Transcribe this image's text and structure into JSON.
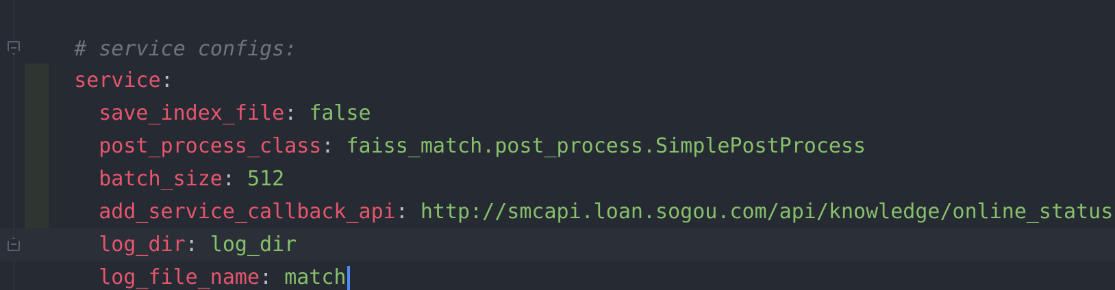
{
  "comment": "# service configs:",
  "root_key": "service",
  "colon": ":",
  "entries": [
    {
      "key": "save_index_file",
      "value": "false"
    },
    {
      "key": "post_process_class",
      "value": "faiss_match.post_process.SimplePostProcess"
    },
    {
      "key": "batch_size",
      "value": "512"
    },
    {
      "key": "add_service_callback_api",
      "value": "http://smcapi.loan.sogou.com/api/knowledge/online_status"
    },
    {
      "key": "log_dir",
      "value": "log_dir"
    },
    {
      "key": "log_file_name",
      "value": "match"
    }
  ],
  "colors": {
    "background": "#262a33",
    "key": "#e5566d",
    "value": "#86c06b",
    "comment": "#6f737c",
    "caret": "#4f8cf7"
  },
  "icons": [
    "fold-open-icon",
    "fold-close-icon"
  ]
}
